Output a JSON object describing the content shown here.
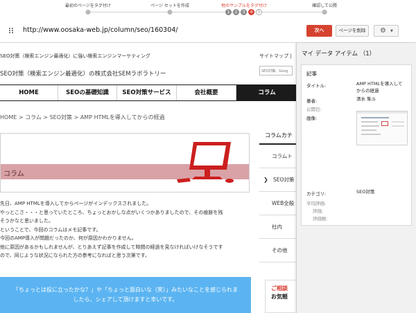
{
  "wizard": {
    "steps": [
      "最初のページをタグ付け",
      "ページ セットを作成",
      "他のサンプルをタグ付け",
      "確認して公開"
    ],
    "substeps": [
      "1",
      "2",
      "3",
      "4",
      "5"
    ],
    "active_step_color": "#db4437"
  },
  "toolbar": {
    "url": "http://www.oosaka-web.jp/column/seo/160304/",
    "next_label": "次へ",
    "delete_label": "ページを削除",
    "settings_icon": "gear-icon",
    "next_color": "#d64230"
  },
  "site": {
    "header_tagline": "SEO対策（検索エンジン最適化）に強い検索エンジンマーケティング",
    "header_links": "サイトマップ |",
    "company_name": "SEO対策（検索エンジン最適化）の株式会社SEMラボラトリー",
    "search_placeholder": "SEO対策、Goog",
    "nav": [
      "HOME",
      "SEOの基礎知識",
      "SEO対策サービス",
      "会社概要",
      "コラム"
    ],
    "breadcrumb": "HOME > コラム > SEO対策 > AMP HTMLを導入してからの経過",
    "hero_title": "コラム",
    "body": [
      "先日、AMP HTMLを導入してからページがインデックスされました。",
      "やっとこさ・・・と思っていたところ、ちょっとおかしな点がいくつかありましたので、その痕跡を残",
      "そうかなと思いました。",
      "ということで、今回のコラムはメモ記事です。",
      "今回のAMP導入が問題だったのか、何が原因かわかりません。",
      "他に原因があるかもしれませんが、とりあえず記事を作成して時間の経過を見なければいけなそうです",
      "ので、同じような状況になられた方の参考になればと思う次第です。"
    ],
    "cta_lines": [
      "「ちょっとは役に立ったかな？」や「ちょっと面白いな（笑）」みたいなことを感じられま",
      "したら、シェアして頂けますと幸いです。"
    ],
    "sidebar_heading": "コラムカテ",
    "sidebar_items": [
      "コラムト",
      "SEO対策",
      "WEB全般",
      "社内",
      "その他"
    ],
    "contact_line1": "ご相談",
    "contact_line2": "お気軽",
    "accent_red": "#cc1f1f",
    "cta_color": "#5bb4f1"
  },
  "panel": {
    "title": "マイ データ アイテム （1）",
    "section": "記事",
    "fields": {
      "title_label": "タイトル:",
      "title_value_lines": [
        "AMP HTMLを導入して",
        "からの経過"
      ],
      "author_label": "著者:",
      "author_value": "清水 隼斗",
      "published_label": "公開日:",
      "image_label": "画像:",
      "category_label": "カテゴリ:",
      "category_value": "SEO対策",
      "avg_rating_label": "平均評価:",
      "rating_label": "評価:",
      "rating_count_label": "評価数:"
    }
  }
}
